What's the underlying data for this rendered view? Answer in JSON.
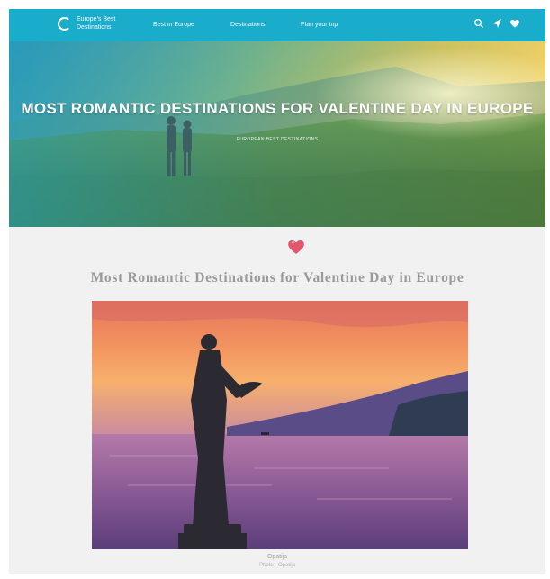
{
  "nav": {
    "logo_text": "Europe's Best Destinations",
    "links": [
      "Best in Europe",
      "Destinations",
      "Plan your trip"
    ],
    "icons": [
      "search-icon",
      "plane-icon",
      "heart-icon"
    ]
  },
  "hero": {
    "title": "MOST ROMANTIC DESTINATIONS FOR VALENTINE DAY IN EUROPE",
    "subtitle": "EUROPEAN BEST DESTINATIONS"
  },
  "article": {
    "title": "Most Romantic Destinations for Valentine Day in Europe"
  },
  "photo": {
    "caption": "Opatija",
    "credit": "Photo · Opatija"
  },
  "colors": {
    "nav": "#1aaccb",
    "heart": "#e0576e",
    "heading": "#9a9a9a"
  }
}
